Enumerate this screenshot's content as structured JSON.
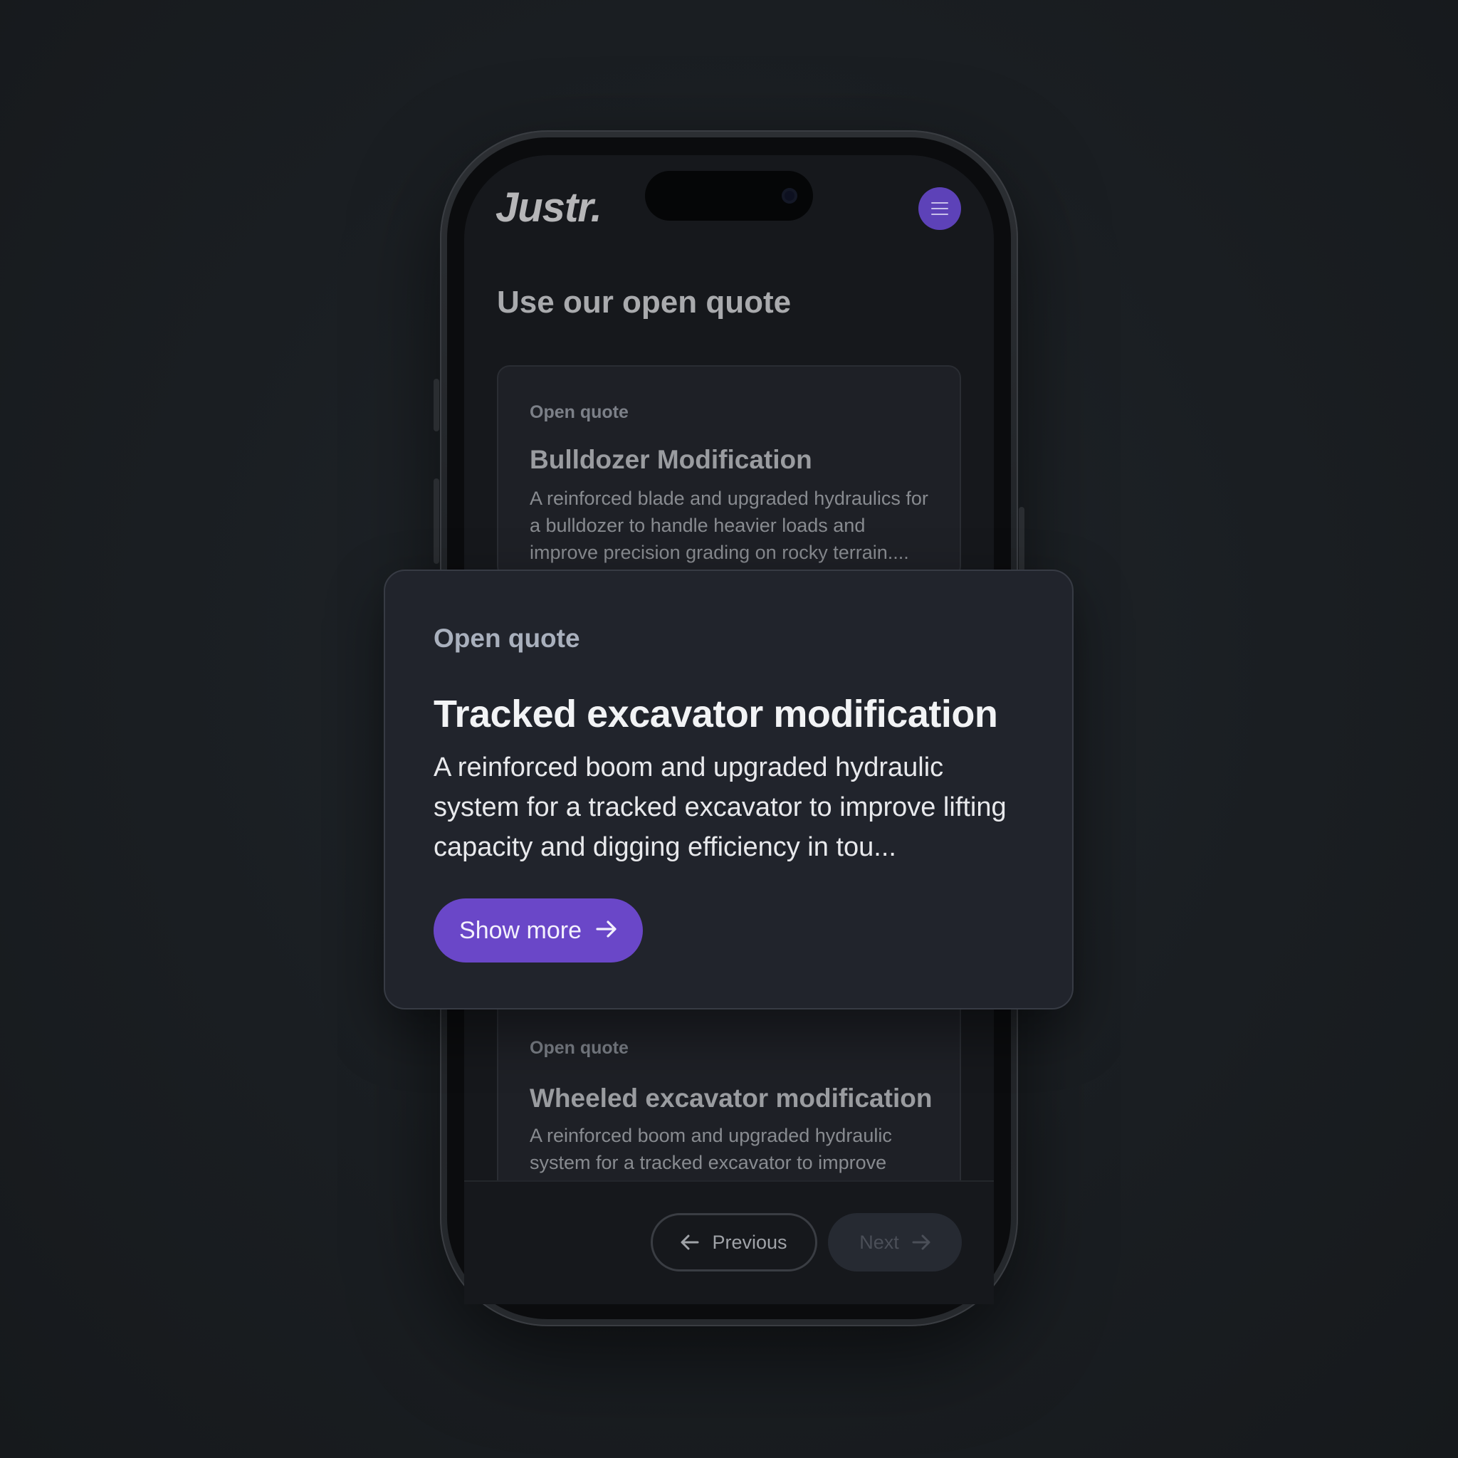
{
  "app": {
    "logo_text": "Justr.",
    "menu_icon": "hamburger-menu-icon",
    "accent_color": "#6a47c8"
  },
  "page": {
    "title": "Use our open quote"
  },
  "cards": [
    {
      "eyebrow": "Open quote",
      "title": "Bulldozer Modification",
      "description": "A reinforced blade and upgraded hydraulics for a bulldozer to handle heavier loads and improve precision grading on rocky terrain...."
    },
    {
      "eyebrow": "Open quote",
      "title": "Tracked excavator modification",
      "description": "A reinforced boom and upgraded hydraulic system for a tracked excavator to improve lifting capacity and digging efficiency in tou...",
      "button_label": "Show more",
      "button_icon": "arrow-right-icon"
    },
    {
      "eyebrow": "Open quote",
      "title": "Wheeled excavator modification",
      "description": "A reinforced boom and upgraded hydraulic system for a tracked excavator to improve"
    }
  ],
  "pagination": {
    "previous_label": "Previous",
    "previous_icon": "arrow-left-icon",
    "next_label": "Next",
    "next_icon": "arrow-right-icon"
  }
}
